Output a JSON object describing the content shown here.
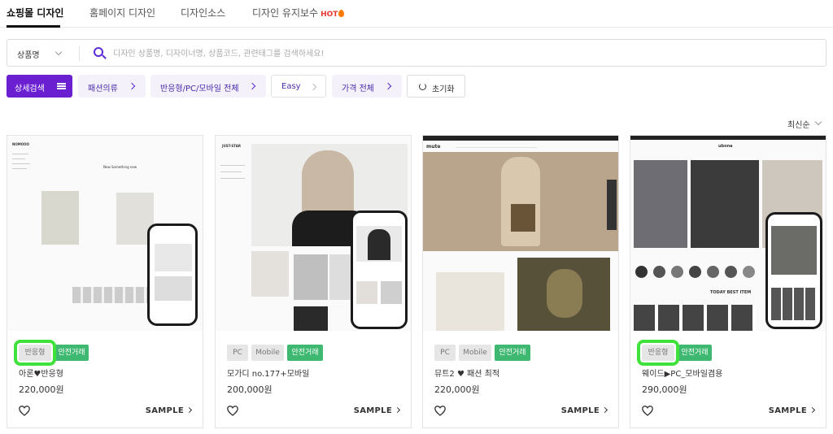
{
  "tabs": [
    {
      "label": "쇼핑몰 디자인",
      "active": true
    },
    {
      "label": "홈페이지 디자인",
      "active": false
    },
    {
      "label": "디자인소스",
      "active": false
    },
    {
      "label": "디자인 유지보수",
      "active": false,
      "badge": "HOT"
    }
  ],
  "search": {
    "select_value": "상품명",
    "placeholder": "디자인 상품명, 디자이너명, 상품코드, 관련태그를 검색하세요!"
  },
  "filters": {
    "detail_search": "상세검색",
    "category": "패션의류",
    "device": "반응형/PC/모바일 전체",
    "difficulty": "Easy",
    "price": "가격 전체",
    "reset": "초기화"
  },
  "sort": {
    "label": "최신순"
  },
  "products": [
    {
      "tags": [
        "반응형",
        "안전거래"
      ],
      "name": "아론♥반응형",
      "price": "220,000원",
      "sample": "SAMPLE",
      "thumb_brand": "NOMOOO",
      "thumb_caption": "New Something new"
    },
    {
      "tags": [
        "PC",
        "Mobile",
        "안전거래"
      ],
      "name": "모가디 no.177+모바일",
      "price": "200,000원",
      "sample": "SAMPLE",
      "thumb_brand": "JUST-STAR"
    },
    {
      "tags": [
        "PC",
        "Mobile",
        "안전거래"
      ],
      "name": "뮤트2 ♥ 패션 최적",
      "price": "220,000원",
      "sample": "SAMPLE",
      "thumb_brand": "mute"
    },
    {
      "tags": [
        "반응형",
        "안전거래"
      ],
      "name": "웨이드▶PC_모바일겸용",
      "price": "290,000원",
      "sample": "SAMPLE",
      "thumb_brand": "ubona",
      "thumb_caption": "TODAY BEST ITEM"
    }
  ],
  "colors": {
    "accent": "#6a1fd1",
    "safe_trade": "#3fb871",
    "highlight": "#3fe23a"
  }
}
